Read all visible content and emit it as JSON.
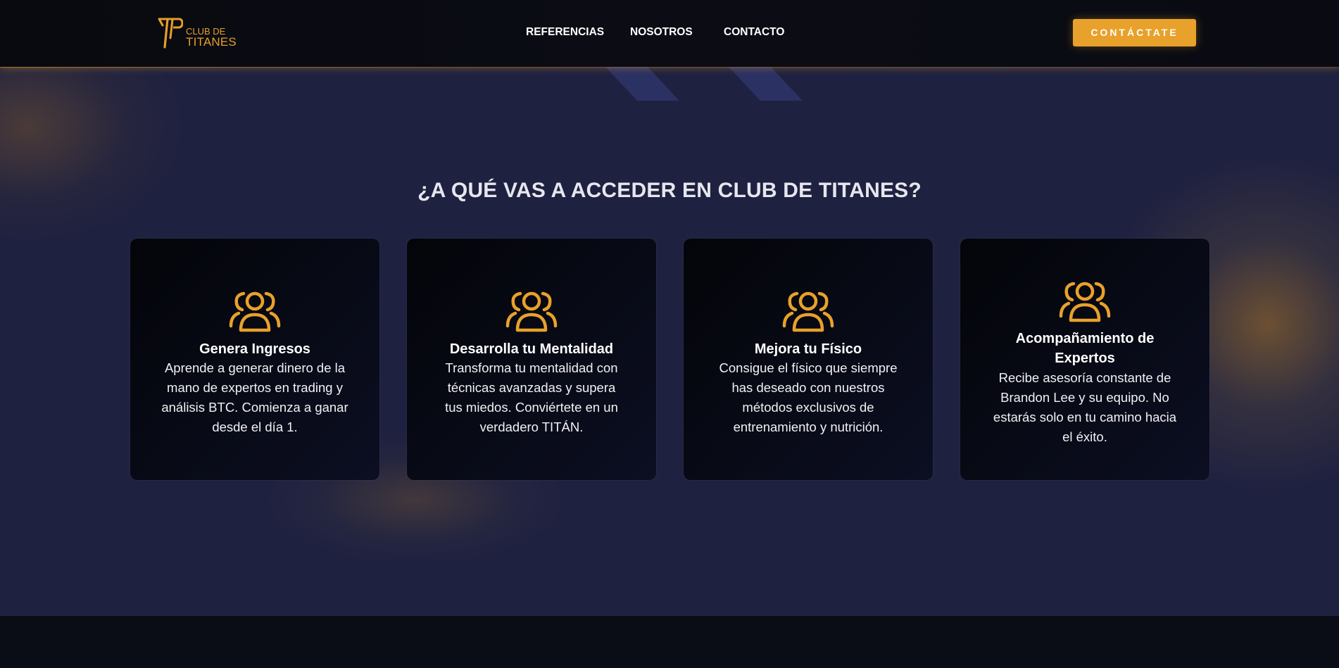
{
  "header": {
    "logo": {
      "line1": "CLUB DE",
      "line2": "TITANES"
    },
    "nav": [
      {
        "label": "REFERENCIAS"
      },
      {
        "label": "NOSOTROS"
      },
      {
        "label": "CONTACTO"
      }
    ],
    "cta_label": "CONTÁCTATE"
  },
  "section": {
    "title": "¿A QUÉ VAS A ACCEDER EN CLUB DE TITANES?"
  },
  "cards": [
    {
      "icon": "users-group-icon",
      "title": "Genera Ingresos",
      "desc_lines": [
        "Aprende a generar dinero de la",
        "mano de expertos en trading y",
        "análisis BTC. Comienza a ganar",
        "desde el día 1."
      ]
    },
    {
      "icon": "users-group-icon",
      "title": "Desarrolla tu Mentalidad",
      "desc_lines": [
        "Transforma tu mentalidad con",
        "técnicas avanzadas y supera",
        "tus miedos. Conviértete en un",
        "verdadero TITÁN."
      ]
    },
    {
      "icon": "users-group-icon",
      "title": "Mejora tu Físico",
      "desc_lines": [
        "Consigue el físico que siempre",
        "has deseado con nuestros",
        "métodos exclusivos de",
        "entrenamiento y nutrición."
      ]
    },
    {
      "icon": "users-group-icon",
      "title_lines": [
        "Acompañamiento de",
        "Expertos"
      ],
      "desc_lines": [
        "Recibe asesoría constante de",
        "Brandon Lee y su equipo. No",
        "estarás solo en tu camino hacia",
        "el éxito."
      ]
    }
  ],
  "colors": {
    "accent": "#e8a12a",
    "background": "#1f2140",
    "header": "#0a0b12",
    "card": "#05060d",
    "footer": "#0a0d15"
  }
}
